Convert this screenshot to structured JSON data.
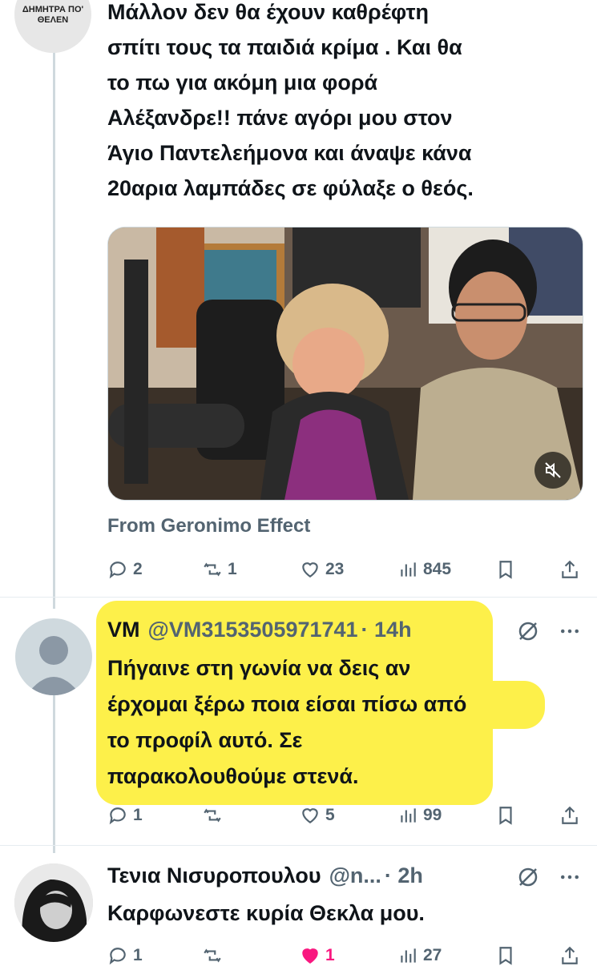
{
  "tweets": [
    {
      "author_badge_text": "ΔΗΜΗΤΡΑ ΠΟ' ΘΕΛΕΝ",
      "text_lines": [
        "Μάλλον δεν θα έχουν καθρέφτη",
        "σπίτι τους τα παιδιά κρίμα . Και θα",
        "το πω για ακόμη μια φορά",
        "Αλέξανδρε!! πάνε αγόρι μου στον",
        "Άγιο Παντελεήμονα και άναψε κάνα",
        "20αρια λαμπάδες σε φύλαξε ο θεός."
      ],
      "media_source": "From Geronimo Effect",
      "replies": "2",
      "retweets": "1",
      "likes": "23",
      "views": "845"
    },
    {
      "name": "VM",
      "handle": "@VM3153505971741",
      "time": "· 14h",
      "text_lines": [
        "Πήγαινε στη γωνία να δεις αν",
        "έρχομαι ξέρω ποια είσαι πίσω από",
        "το προφίλ αυτό. Σε",
        "παρακολουθούμε στενά."
      ],
      "replies": "1",
      "retweets": "",
      "likes": "5",
      "views": "99"
    },
    {
      "name": "Τενια Νισυροπουλου",
      "handle": "@n...",
      "time": "· 2h",
      "text_lines": [
        "Καρφωνεστε κυρία Θεκλα μου."
      ],
      "replies": "1",
      "retweets": "",
      "likes": "1",
      "views": "27"
    }
  ],
  "colors": {
    "highlight": "#fdf04a",
    "secondary_text": "#536471",
    "like_active": "#f91880"
  },
  "icons": {
    "reply": "reply-icon",
    "retweet": "retweet-icon",
    "like": "heart-icon",
    "views": "views-icon",
    "bookmark": "bookmark-icon",
    "share": "share-icon",
    "muted": "speaker-muted-icon",
    "more": "more-icon",
    "hidden": "hidden-reply-icon"
  }
}
